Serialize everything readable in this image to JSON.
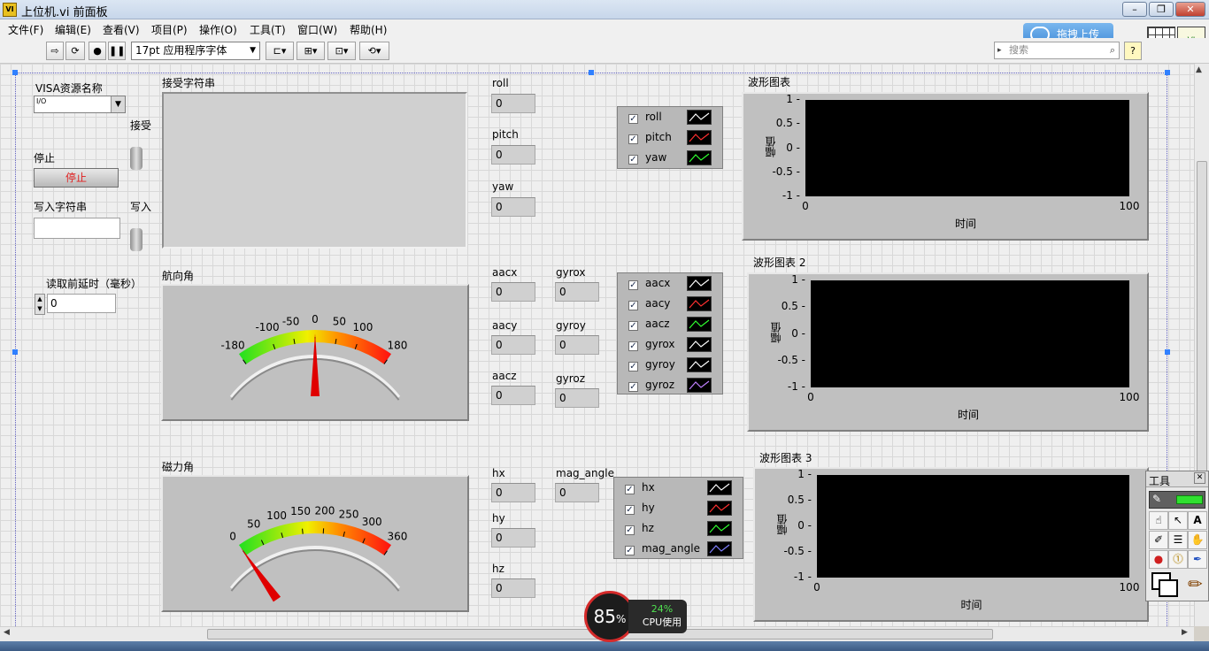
{
  "window": {
    "title": "上位机.vi 前面板",
    "app_icon": "labview-icon",
    "buttons": [
      "minimize",
      "restore",
      "close"
    ]
  },
  "menu": [
    "文件(F)",
    "编辑(E)",
    "查看(V)",
    "项目(P)",
    "操作(O)",
    "工具(T)",
    "窗口(W)",
    "帮助(H)"
  ],
  "toolbar": {
    "font": "17pt 应用程序字体",
    "search_placeholder": "搜索",
    "upload_label": "拖拽上传",
    "help": "?"
  },
  "controls": {
    "visa_label": "VISA资源名称",
    "visa_prefix": "I/O",
    "receive_label": "接受",
    "stop_label": "停止",
    "stop_button": "停止",
    "write_string_label": "写入字符串",
    "write_label": "写入",
    "delay_label": "读取前延时（毫秒）",
    "delay_value": "0",
    "receive_string_label": "接受字符串"
  },
  "indicators": {
    "roll": {
      "label": "roll",
      "value": "0"
    },
    "pitch": {
      "label": "pitch",
      "value": "0"
    },
    "yaw": {
      "label": "yaw",
      "value": "0"
    },
    "aacx": {
      "label": "aacx",
      "value": "0"
    },
    "aacy": {
      "label": "aacy",
      "value": "0"
    },
    "aacz": {
      "label": "aacz",
      "value": "0"
    },
    "gyrox": {
      "label": "gyrox",
      "value": "0"
    },
    "gyroy": {
      "label": "gyroy",
      "value": "0"
    },
    "gyroz": {
      "label": "gyroz",
      "value": "0"
    },
    "hx": {
      "label": "hx",
      "value": "0"
    },
    "hy": {
      "label": "hy",
      "value": "0"
    },
    "hz": {
      "label": "hz",
      "value": "0"
    },
    "mag_angle": {
      "label": "mag_angle",
      "value": "0"
    }
  },
  "gauges": {
    "heading": {
      "label": "航向角",
      "min": -180,
      "max": 180,
      "ticks": [
        "-180",
        "-100",
        "-50",
        "0",
        "50",
        "100",
        "180"
      ],
      "tick_values": [
        -180,
        -100,
        -50,
        0,
        50,
        100,
        180
      ],
      "value": 0
    },
    "magnetic": {
      "label": "磁力角",
      "min": 0,
      "max": 360,
      "ticks": [
        "0",
        "50",
        "100",
        "150",
        "200",
        "250",
        "300",
        "360"
      ],
      "tick_values": [
        0,
        50,
        100,
        150,
        200,
        250,
        300,
        360
      ],
      "value": 0
    }
  },
  "charts": [
    {
      "title": "波形图表",
      "ylabel": "幅值",
      "xlabel": "时间",
      "yticks": [
        "1",
        "0.5",
        "0",
        "-0.5",
        "-1"
      ],
      "xticks": [
        "0",
        "100"
      ],
      "legend": [
        {
          "name": "roll",
          "color": "#ffffff"
        },
        {
          "name": "pitch",
          "color": "#ff3030"
        },
        {
          "name": "yaw",
          "color": "#30ff30"
        }
      ]
    },
    {
      "title": "波形图表 2",
      "ylabel": "幅值",
      "xlabel": "时间",
      "yticks": [
        "1",
        "0.5",
        "0",
        "-0.5",
        "-1"
      ],
      "xticks": [
        "0",
        "100"
      ],
      "legend": [
        {
          "name": "aacx",
          "color": "#ffffff"
        },
        {
          "name": "aacy",
          "color": "#ff3030"
        },
        {
          "name": "aacz",
          "color": "#30ff30"
        },
        {
          "name": "gyrox",
          "color": "#ffffff"
        },
        {
          "name": "gyroy",
          "color": "#ffffff"
        },
        {
          "name": "gyroz",
          "color": "#c080ff"
        }
      ]
    },
    {
      "title": "波形图表 3",
      "ylabel": "幅值",
      "xlabel": "时间",
      "yticks": [
        "1",
        "0.5",
        "0",
        "-0.5",
        "-1"
      ],
      "xticks": [
        "0",
        "100"
      ],
      "legend": [
        {
          "name": "hx",
          "color": "#ffffff"
        },
        {
          "name": "hy",
          "color": "#ff3030"
        },
        {
          "name": "hz",
          "color": "#30ff30"
        },
        {
          "name": "mag_angle",
          "color": "#8080ff"
        }
      ]
    }
  ],
  "tools_palette": {
    "title": "工具"
  },
  "cpu_widget": {
    "percent": "85",
    "percent_unit": "%",
    "secondary": "24%",
    "secondary_label": "CPU使用"
  }
}
